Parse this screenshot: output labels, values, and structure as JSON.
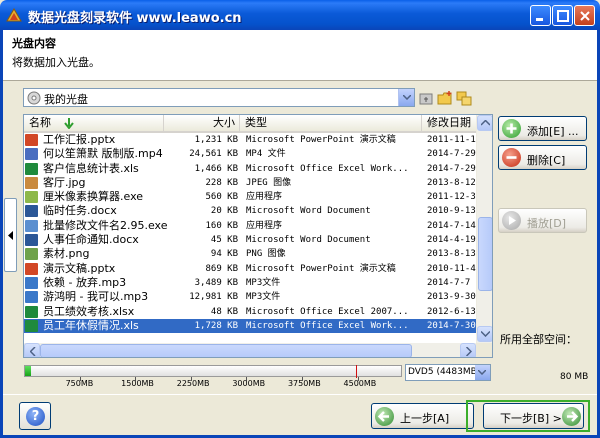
{
  "window": {
    "title": "数据光盘刻录软件 www.leawo.cn"
  },
  "header": {
    "heading": "光盘内容",
    "subtitle": "将数据加入光盘。"
  },
  "disc_selector": {
    "value": "我的光盘"
  },
  "list": {
    "columns": [
      "名称",
      "大小",
      "类型",
      "修改日期"
    ],
    "rows": [
      {
        "name": "工作汇报.pptx",
        "size": "1,231 KB",
        "type": "Microsoft PowerPoint 演示文稿",
        "date": "2011-11-1",
        "icon": "ppt-icon",
        "color": "#D24726",
        "selected": false
      },
      {
        "name": "何以笙箫默 版制版.mp4",
        "size": "24,561 KB",
        "type": "MP4 文件",
        "date": "2014-7-29",
        "icon": "video-icon",
        "color": "#4A6EC0",
        "selected": false
      },
      {
        "name": "客户信息统计表.xls",
        "size": "1,466 KB",
        "type": "Microsoft Office Excel Work...",
        "date": "2014-7-29",
        "icon": "excel-icon",
        "color": "#1F8A3C",
        "selected": false
      },
      {
        "name": "客厅.jpg",
        "size": "228 KB",
        "type": "JPEG 图像",
        "date": "2013-8-12",
        "icon": "image-icon",
        "color": "#C98A3E",
        "selected": false
      },
      {
        "name": "厘米像素换算器.exe",
        "size": "560 KB",
        "type": "应用程序",
        "date": "2011-12-3",
        "icon": "app-icon",
        "color": "#8DB84A",
        "selected": false
      },
      {
        "name": "临时任务.docx",
        "size": "20 KB",
        "type": "Microsoft Word Document",
        "date": "2010-9-13",
        "icon": "word-icon",
        "color": "#2B5797",
        "selected": false
      },
      {
        "name": "批量修改文件名2.95.exe",
        "size": "160 KB",
        "type": "应用程序",
        "date": "2014-7-14",
        "icon": "app-icon",
        "color": "#5A8FD0",
        "selected": false
      },
      {
        "name": "人事任命通知.docx",
        "size": "45 KB",
        "type": "Microsoft Word Document",
        "date": "2014-4-19",
        "icon": "word-icon",
        "color": "#2B5797",
        "selected": false
      },
      {
        "name": "素材.png",
        "size": "94 KB",
        "type": "PNG 图像",
        "date": "2013-8-13",
        "icon": "image-icon",
        "color": "#6FA24A",
        "selected": false
      },
      {
        "name": "演示文稿.pptx",
        "size": "869 KB",
        "type": "Microsoft PowerPoint 演示文稿",
        "date": "2010-11-4",
        "icon": "ppt-icon",
        "color": "#D24726",
        "selected": false
      },
      {
        "name": "依赖 - 放弃.mp3",
        "size": "3,489 KB",
        "type": "MP3文件",
        "date": "2014-7-7",
        "icon": "audio-icon",
        "color": "#3A78C9",
        "selected": false
      },
      {
        "name": "游鸿明 - 我可以.mp3",
        "size": "12,981 KB",
        "type": "MP3文件",
        "date": "2013-9-30",
        "icon": "audio-icon",
        "color": "#3A78C9",
        "selected": false
      },
      {
        "name": "员工绩效考核.xlsx",
        "size": "48 KB",
        "type": "Microsoft Office Excel 2007...",
        "date": "2012-6-13",
        "icon": "excel-icon",
        "color": "#1F8A3C",
        "selected": false
      },
      {
        "name": "员工年休假情况.xls",
        "size": "1,728 KB",
        "type": "Microsoft Office Excel Work...",
        "date": "2014-7-30",
        "icon": "excel-icon",
        "color": "#1F8A3C",
        "selected": true
      }
    ]
  },
  "actions": {
    "add": "添加[E] ...",
    "delete": "删除[C]",
    "play": "播放[D]"
  },
  "space": {
    "label": "所用全部空间：",
    "value": "80 MB",
    "used_fraction": 0.016
  },
  "capacity": {
    "ticks": [
      "750MB",
      "1500MB",
      "2250MB",
      "3000MB",
      "3750MB",
      "4500MB"
    ],
    "limit_mb": 4483,
    "max_mb": 5100
  },
  "disc_type": {
    "value": "DVD5 (4483MB)"
  },
  "nav": {
    "back": "上一步[A]",
    "next": "下一步[B] >"
  }
}
